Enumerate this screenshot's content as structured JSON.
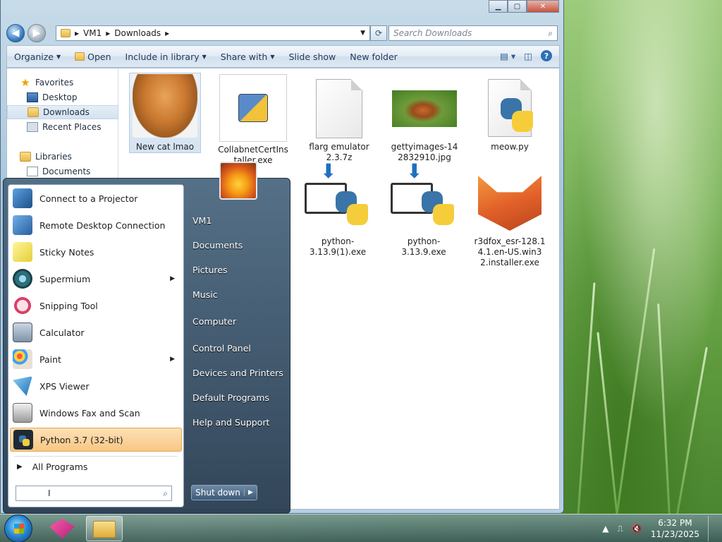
{
  "explorer": {
    "breadcrumb": [
      "VM1",
      "Downloads"
    ],
    "search_placeholder": "Search Downloads",
    "toolbar": [
      "Organize",
      "Open",
      "Include in library",
      "Share with",
      "Slide show",
      "New folder"
    ],
    "nav": {
      "favorites_label": "Favorites",
      "favorites": [
        "Desktop",
        "Downloads",
        "Recent Places"
      ],
      "libraries_label": "Libraries",
      "libraries": [
        "Documents"
      ]
    },
    "files": [
      {
        "name": "New cat lmao"
      },
      {
        "name": "CollabnetCertInstaller.exe"
      },
      {
        "name": "flarg emulator 2.3.7z"
      },
      {
        "name": "gettyimages-142832910.jpg"
      },
      {
        "name": "meow.py"
      },
      {
        "name": "python-3.13.9(1).exe"
      },
      {
        "name": "python-3.13.9.exe"
      },
      {
        "name": "r3dfox_esr-128.14.1.en-US.win32.installer.exe"
      }
    ]
  },
  "start_menu": {
    "programs": [
      {
        "label": "Connect to a Projector"
      },
      {
        "label": "Remote Desktop Connection"
      },
      {
        "label": "Sticky Notes"
      },
      {
        "label": "Supermium"
      },
      {
        "label": "Snipping Tool"
      },
      {
        "label": "Calculator"
      },
      {
        "label": "Paint"
      },
      {
        "label": "XPS Viewer"
      },
      {
        "label": "Windows Fax and Scan"
      },
      {
        "label": "Python 3.7 (32-bit)"
      }
    ],
    "all_programs": "All Programs",
    "right_items": [
      "VM1",
      "Documents",
      "Pictures",
      "Music",
      "Computer",
      "Control Panel",
      "Devices and Printers",
      "Default Programs",
      "Help and Support"
    ],
    "shutdown_label": "Shut down"
  },
  "taskbar": {
    "time": "6:32 PM",
    "date": "11/23/2025"
  },
  "colors": {
    "accent": "#2c6fb7",
    "highlight": "#f8c784"
  }
}
